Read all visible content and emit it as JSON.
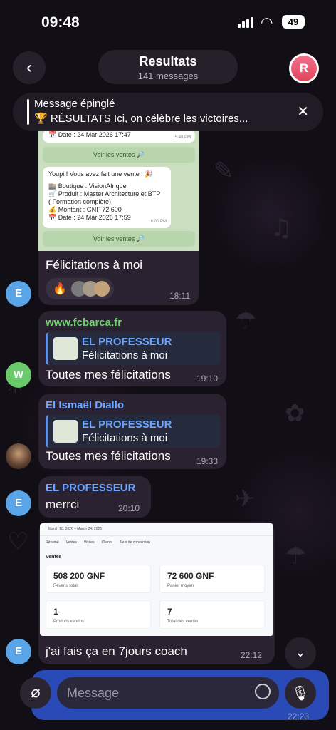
{
  "status_bar": {
    "time": "09:48",
    "battery": "49"
  },
  "header": {
    "title": "Resultats",
    "subtitle": "141 messages",
    "avatar_letter": "R"
  },
  "pinned": {
    "label": "Message épinglé",
    "text": "🏆 RÉSULTATS Ici, on célèbre les victoires..."
  },
  "messages": [
    {
      "sale_card_top": {
        "date": "📅 Date : 24 Mar 2026 17:47",
        "time": "5:48 PM",
        "button": "Voir les ventes 🔎"
      },
      "sale_card": {
        "line1": "Youpi ! Vous avez fait une vente ! 🎉",
        "line2": "🏬 Boutique : VisionAfrique",
        "line3": "🛒 Produit : Master Architecture et BTP",
        "line4": "( Formation complète)",
        "line5": "💰 Montant : GNF 72,600",
        "line6": "📅 Date : 24 Mar 2026 17:59",
        "time": "6:00 PM",
        "button": "Voir les ventes 🔎"
      },
      "text": "Félicitations à moi",
      "reaction": "🔥",
      "time": "18:11",
      "avatar": "E"
    },
    {
      "sender": "www.fcbarca.fr",
      "quote_author": "EL PROFESSEUR",
      "quote_text": "Félicitations à moi",
      "text": "Toutes mes félicitations",
      "time": "19:10",
      "avatar": "W"
    },
    {
      "sender": "El Ismaël Diallo",
      "quote_author": "EL PROFESSEUR",
      "quote_text": "Félicitations à moi",
      "text": "Toutes mes félicitations",
      "time": "19:33"
    },
    {
      "sender": "EL PROFESSEUR",
      "text": "merrci",
      "time": "20:10",
      "avatar": "E"
    },
    {
      "dashboard": {
        "daterange": "March 18, 2026 – March 24, 2026",
        "tabs": [
          "Résumé",
          "Ventes",
          "Visites",
          "Clients",
          "Taux de conversion"
        ],
        "section": "Ventes",
        "kpis": [
          {
            "value": "508 200 GNF",
            "label": "Revenu total"
          },
          {
            "value": "72 600 GNF",
            "label": "Panier moyen"
          },
          {
            "value": "1",
            "label": "Produits vendus"
          },
          {
            "value": "7",
            "label": "Total des ventes"
          }
        ]
      },
      "text": "j'ai fais ça en 7jours coach",
      "time": "22:12",
      "avatar": "E"
    }
  ],
  "composer": {
    "placeholder": "Message",
    "time": "22:23"
  },
  "colors": {
    "accent_green": "#6fd26b",
    "accent_blue": "#6ea6ff",
    "bubble": "#2a2230",
    "composer": "#2f55d4"
  }
}
